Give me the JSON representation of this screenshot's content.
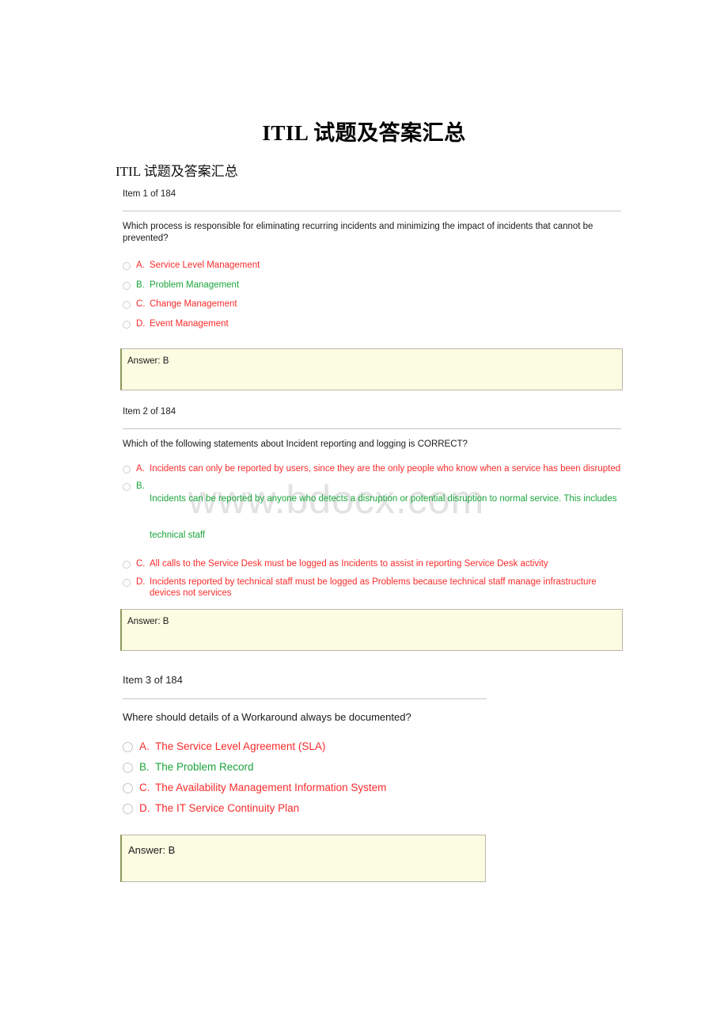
{
  "document": {
    "title": "ITIL 试题及答案汇总",
    "subtitle": "ITIL 试题及答案汇总",
    "watermark": "www.bdocx.com"
  },
  "questions": [
    {
      "item_label": "Item 1 of 184",
      "question": "Which process is responsible for eliminating recurring incidents and minimizing the impact of incidents that cannot be prevented?",
      "options": [
        {
          "letter": "A.",
          "text": "Service Level Management",
          "state": "incorrect"
        },
        {
          "letter": "B.",
          "text": "Problem Management",
          "state": "correct"
        },
        {
          "letter": "C.",
          "text": "Change Management",
          "state": "incorrect"
        },
        {
          "letter": "D.",
          "text": "Event Management",
          "state": "incorrect"
        }
      ],
      "answer": "Answer: B"
    },
    {
      "item_label": "Item 2 of 184",
      "question": "Which of the following statements about Incident reporting and logging is CORRECT?",
      "options": [
        {
          "letter": "A.",
          "text": "Incidents can only be reported by users, since they are the only people who know when a service has been disrupted",
          "state": "incorrect"
        },
        {
          "letter": "B.",
          "text": "Incidents can be reported by anyone who detects a disruption or potential disruption to normal service. This includes technical staff",
          "state": "correct"
        },
        {
          "letter": "C.",
          "text": "All calls to the Service Desk must be logged as Incidents to assist in reporting Service Desk activity",
          "state": "incorrect"
        },
        {
          "letter": "D.",
          "text": "Incidents reported by technical staff must be logged as Problems because technical staff manage infrastructure devices not services",
          "state": "incorrect"
        }
      ],
      "answer": "Answer: B"
    },
    {
      "item_label": "Item 3 of 184",
      "question": "Where should details of a Workaround always be documented?",
      "options": [
        {
          "letter": "A.",
          "text": "The Service Level Agreement (SLA)",
          "state": "incorrect"
        },
        {
          "letter": "B.",
          "text": "The Problem Record",
          "state": "correct"
        },
        {
          "letter": "C.",
          "text": "The Availability Management Information System",
          "state": "incorrect"
        },
        {
          "letter": "D.",
          "text": "The IT Service Continuity Plan",
          "state": "incorrect"
        }
      ],
      "answer": "Answer: B"
    }
  ],
  "colors": {
    "incorrect": "#fa2b2b",
    "correct": "#1ba53c",
    "answer_box_bg": "#fcfce2",
    "answer_box_border": "#b9b6a8",
    "rule": "#c9c6c0",
    "watermark": "#e2e2e2"
  }
}
